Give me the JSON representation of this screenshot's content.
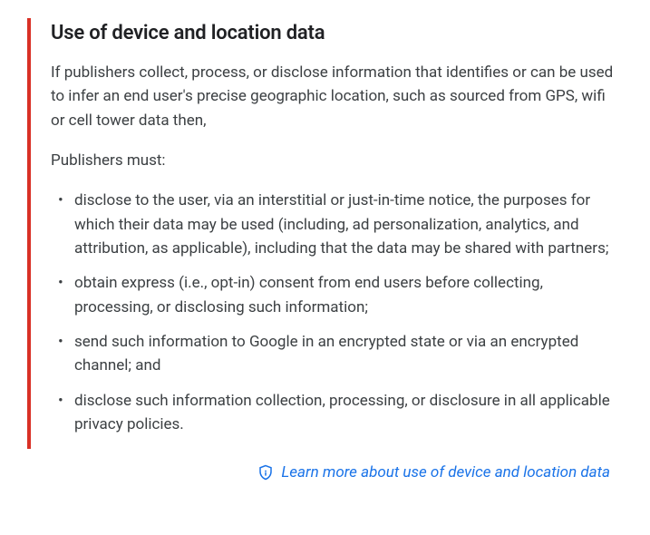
{
  "section": {
    "heading": "Use of device and location data",
    "intro": "If publishers collect, process, or disclose information that identifies or can be used to infer an end user's precise geographic location, such as sourced from GPS, wifi or cell tower data then,",
    "lead_in": "Publishers must:",
    "requirements": [
      "disclose to the user, via an interstitial or just-in-time notice, the purposes for which their data may be used (including, ad personalization, analytics, and attribution, as applicable), including that the data may be shared with partners;",
      "obtain express (i.e., opt-in) consent from end users before collecting, processing, or disclosing such information;",
      "send such information to Google in an encrypted state or via an encrypted channel; and",
      "disclose such information collection, processing, or disclosure in all applicable privacy policies."
    ]
  },
  "learn_more": {
    "label": "Learn more about use of device and location data"
  },
  "colors": {
    "accent_border": "#d93025",
    "link": "#1a73e8"
  }
}
